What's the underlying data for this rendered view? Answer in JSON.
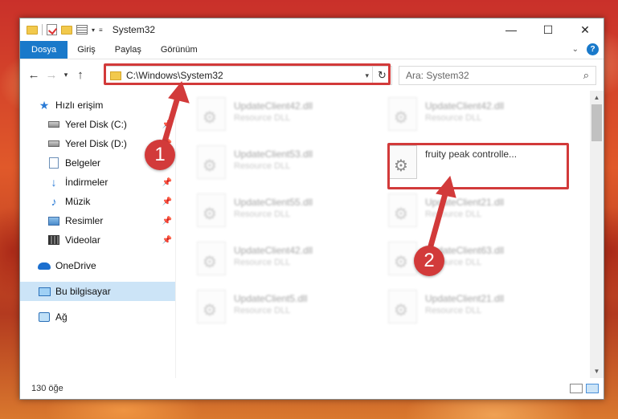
{
  "window": {
    "title": "System32",
    "controls": {
      "minimize": "—",
      "maximize": "☐",
      "close": "✕"
    }
  },
  "ribbon": {
    "tabs": [
      "Dosya",
      "Giriş",
      "Paylaş",
      "Görünüm"
    ],
    "help": "?"
  },
  "navigation": {
    "address_path": "C:\\Windows\\System32",
    "search_placeholder": "Ara: System32"
  },
  "sidebar": {
    "items": [
      {
        "label": "Hızlı erişim"
      },
      {
        "label": "Yerel Disk (C:)"
      },
      {
        "label": "Yerel Disk (D:)"
      },
      {
        "label": "Belgeler"
      },
      {
        "label": "İndirmeler"
      },
      {
        "label": "Müzik"
      },
      {
        "label": "Resimler"
      },
      {
        "label": "Videolar"
      },
      {
        "label": "OneDrive"
      },
      {
        "label": "Bu bilgisayar"
      },
      {
        "label": "Ağ"
      }
    ],
    "selected": "Bu bilgisayar"
  },
  "files": {
    "highlighted": {
      "name": "fruity peak controlle...",
      "type": ""
    },
    "left_column": [
      {
        "name": "UpdateClient42.dll",
        "type": "Resource DLL"
      },
      {
        "name": "UpdateClient53.dll",
        "type": "Resource DLL"
      },
      {
        "name": "UpdateClient55.dll",
        "type": "Resource DLL"
      },
      {
        "name": "UpdateClient42.dll",
        "type": "Resource DLL"
      },
      {
        "name": "UpdateClient5.dll",
        "type": "Resource DLL"
      }
    ],
    "right_column": [
      {
        "name": "UpdateClient42.dll",
        "type": "Resource DLL"
      },
      {
        "name": "UpdateClient21.dll",
        "type": "Resource DLL"
      },
      {
        "name": "UpdateClient63.dll",
        "type": "Resource DLL"
      },
      {
        "name": "UpdateClient21.dll",
        "type": "Resource DLL"
      }
    ]
  },
  "status": {
    "item_count": "130 öğe"
  },
  "annotations": {
    "step1": "1",
    "step2": "2",
    "color": "#d23a3a"
  }
}
